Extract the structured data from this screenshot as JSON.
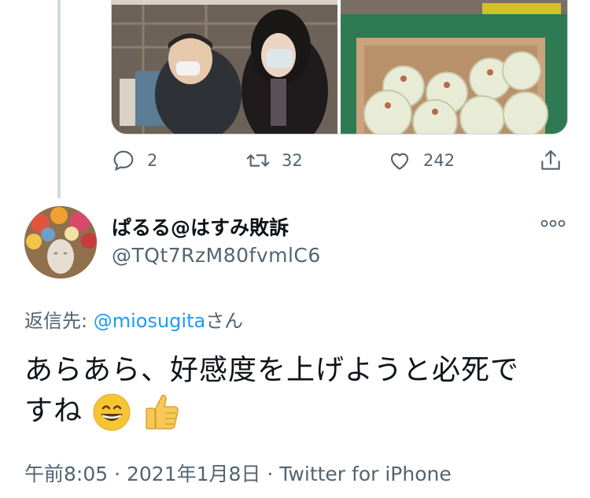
{
  "actions": {
    "reply_count": "2",
    "retweet_count": "32",
    "like_count": "242"
  },
  "reply": {
    "display_name": "ぱるる@はすみ敗訴",
    "handle": "@TQt7RzM80fvmlC6",
    "reply_to_label": "返信先: ",
    "reply_to_user": "@miosugita",
    "reply_to_suffix": "さん",
    "text_line1": "あらあら、好感度を上げようと必死で",
    "text_line2": "すね",
    "emojis": [
      "grinning-face-emoji",
      "thumbs-up-emoji"
    ],
    "time": "午前8:05",
    "date": "2021年1月8日",
    "source": "Twitter for iPhone",
    "separator": "·"
  },
  "colors": {
    "link": "#1d9bf0",
    "secondary_text": "#536471",
    "thread_line": "#cfd9de"
  }
}
